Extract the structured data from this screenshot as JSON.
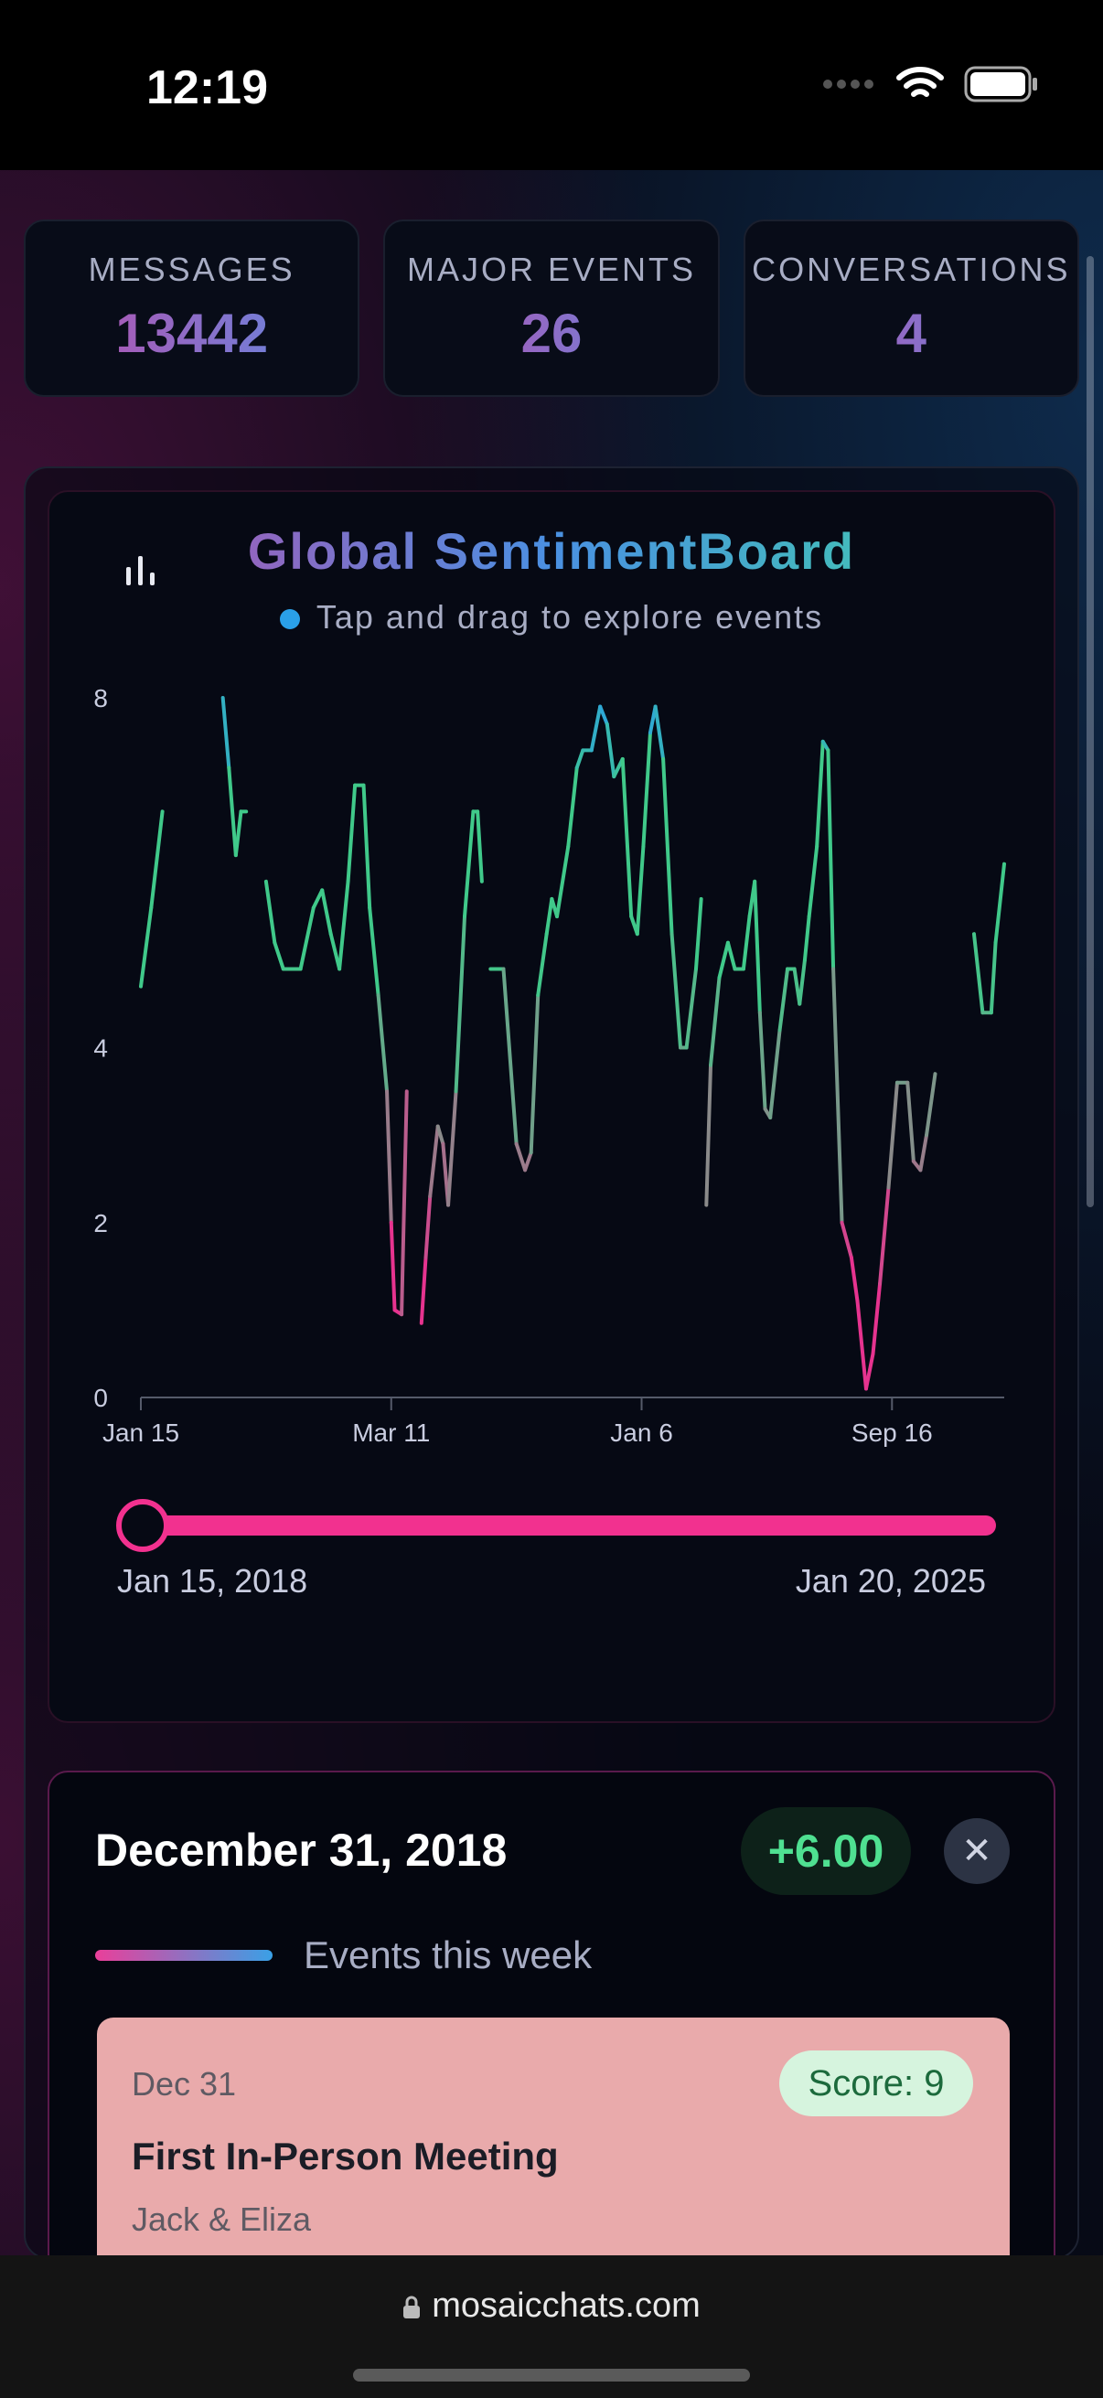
{
  "status_bar": {
    "time": "12:19"
  },
  "stats": [
    {
      "label": "MESSAGES",
      "value": "13442"
    },
    {
      "label": "MAJOR EVENTS",
      "value": "26"
    },
    {
      "label": "CONVERSATIONS",
      "value": "4"
    }
  ],
  "chart_card": {
    "title": "Global SentimentBoard",
    "subtitle": "Tap and drag to explore events",
    "range_start": "Jan 15, 2018",
    "range_end": "Jan 20, 2025",
    "slider_position": 0
  },
  "chart_data": {
    "type": "line",
    "title": "Global SentimentBoard",
    "y_ticks": [
      "0",
      "2",
      "4",
      "8"
    ],
    "ylim": [
      0,
      8
    ],
    "x_tick_labels": [
      "Jan 15",
      "Mar 11",
      "Jan 6",
      "Sep 16"
    ],
    "xlim": [
      0,
      100
    ],
    "x_tick_positions": [
      0,
      29,
      58,
      87
    ],
    "colors": {
      "high": "#40c98a",
      "peak": "#2aa0e8",
      "mid": "#8a8a8a",
      "low": "#e6338f"
    },
    "segments": [
      [
        [
          0,
          4.7
        ],
        [
          1.2,
          5.6
        ],
        [
          2.5,
          6.7
        ]
      ],
      [
        [
          9.5,
          8.0
        ],
        [
          10.2,
          7.2
        ],
        [
          11,
          6.2
        ],
        [
          11.6,
          6.7
        ],
        [
          12.2,
          6.7
        ]
      ],
      [
        [
          14.5,
          5.9
        ],
        [
          15.5,
          5.2
        ],
        [
          16.5,
          4.9
        ],
        [
          18.5,
          4.9
        ],
        [
          20,
          5.6
        ],
        [
          21,
          5.8
        ],
        [
          22,
          5.3
        ],
        [
          23,
          4.9
        ],
        [
          24,
          5.9
        ],
        [
          24.8,
          7.0
        ],
        [
          25.8,
          7.0
        ],
        [
          26.5,
          5.6
        ],
        [
          27.5,
          4.6
        ],
        [
          28.5,
          3.5
        ],
        [
          29,
          2.0
        ],
        [
          29.4,
          1.0
        ],
        [
          30.2,
          0.95
        ],
        [
          30.8,
          3.5
        ]
      ],
      [
        [
          32.5,
          0.85
        ],
        [
          33,
          1.6
        ],
        [
          33.5,
          2.3
        ],
        [
          34.4,
          3.1
        ],
        [
          35,
          2.9
        ],
        [
          35.6,
          2.2
        ],
        [
          36.5,
          3.5
        ],
        [
          37.5,
          5.5
        ],
        [
          38.5,
          6.7
        ],
        [
          39,
          6.7
        ],
        [
          39.5,
          5.9
        ]
      ],
      [
        [
          40.5,
          4.9
        ],
        [
          42,
          4.9
        ],
        [
          43.5,
          2.9
        ],
        [
          44.5,
          2.6
        ],
        [
          45.2,
          2.8
        ],
        [
          46,
          4.6
        ],
        [
          47,
          5.3
        ],
        [
          47.6,
          5.7
        ],
        [
          48.2,
          5.5
        ],
        [
          49.5,
          6.3
        ],
        [
          50.5,
          7.2
        ],
        [
          51.2,
          7.4
        ],
        [
          52.2,
          7.4
        ],
        [
          53.2,
          7.9
        ],
        [
          54,
          7.7
        ],
        [
          54.8,
          7.1
        ],
        [
          55.8,
          7.3
        ],
        [
          56.8,
          5.5
        ],
        [
          57.5,
          5.3
        ],
        [
          58.2,
          6.3
        ],
        [
          59,
          7.6
        ],
        [
          59.6,
          7.9
        ],
        [
          60.5,
          7.3
        ],
        [
          61.5,
          5.3
        ],
        [
          62.5,
          4.0
        ],
        [
          63.2,
          4.0
        ],
        [
          64.3,
          4.9
        ],
        [
          64.9,
          5.7
        ]
      ],
      [
        [
          65.5,
          2.2
        ],
        [
          66,
          3.8
        ],
        [
          67,
          4.8
        ],
        [
          68,
          5.2
        ],
        [
          68.8,
          4.9
        ],
        [
          69.8,
          4.9
        ],
        [
          70.5,
          5.5
        ],
        [
          71.1,
          5.9
        ],
        [
          71.7,
          4.4
        ],
        [
          72.3,
          3.3
        ],
        [
          72.9,
          3.2
        ],
        [
          74,
          4.2
        ],
        [
          74.9,
          4.9
        ],
        [
          75.7,
          4.9
        ],
        [
          76.3,
          4.5
        ],
        [
          76.9,
          5.0
        ],
        [
          77.4,
          5.5
        ],
        [
          78.3,
          6.3
        ],
        [
          79,
          7.5
        ],
        [
          79.6,
          7.4
        ],
        [
          80.2,
          4.9
        ],
        [
          81.2,
          2.0
        ],
        [
          82.3,
          1.6
        ],
        [
          83,
          1.1
        ],
        [
          84,
          0.1
        ],
        [
          84.8,
          0.5
        ],
        [
          85.6,
          1.3
        ],
        [
          86.6,
          2.4
        ],
        [
          87.6,
          3.6
        ],
        [
          88.8,
          3.6
        ],
        [
          89.5,
          2.7
        ],
        [
          90.3,
          2.6
        ],
        [
          91,
          3.0
        ],
        [
          92,
          3.7
        ]
      ],
      [
        [
          96.5,
          5.3
        ],
        [
          97.5,
          4.4
        ],
        [
          98.5,
          4.4
        ],
        [
          99,
          5.2
        ],
        [
          100,
          6.1
        ]
      ]
    ]
  },
  "event": {
    "date": "December 31, 2018",
    "score": "+6.00",
    "week_label": "Events this week",
    "items": [
      {
        "date": "Dec 31",
        "score": "Score: 9",
        "title": "First In-Person Meeting",
        "people": "Jack & Eliza"
      }
    ]
  },
  "browser": {
    "url": "mosaicchats.com"
  }
}
